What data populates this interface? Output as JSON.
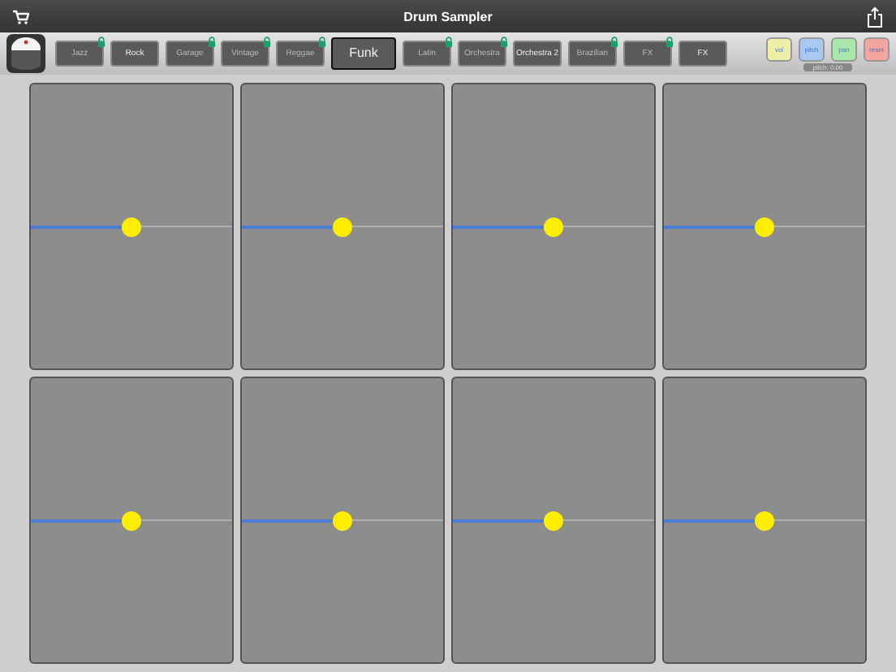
{
  "window": {
    "title": "Drum Sampler"
  },
  "kits": [
    {
      "label": "Jazz",
      "locked": true,
      "selected": false
    },
    {
      "label": "Rock",
      "locked": false,
      "selected": false
    },
    {
      "label": "Garage",
      "locked": true,
      "selected": false
    },
    {
      "label": "Vintage",
      "locked": true,
      "selected": false
    },
    {
      "label": "Reggae",
      "locked": true,
      "selected": false
    },
    {
      "label": "Funk",
      "locked": false,
      "selected": true
    },
    {
      "label": "Latin",
      "locked": true,
      "selected": false
    },
    {
      "label": "Orchestra",
      "locked": true,
      "selected": false
    },
    {
      "label": "Orchestra 2",
      "locked": false,
      "selected": false
    },
    {
      "label": "Brazilian",
      "locked": true,
      "selected": false
    },
    {
      "label": "FX",
      "locked": true,
      "selected": false
    },
    {
      "label": "FX",
      "locked": false,
      "selected": false
    }
  ],
  "modes": [
    {
      "label": "vol",
      "color": "#eef0a8"
    },
    {
      "label": "pitch",
      "color": "#a9c9f2"
    },
    {
      "label": "pan",
      "color": "#a8e8a8"
    },
    {
      "label": "reset",
      "color": "#f4a5a0"
    }
  ],
  "mode_readout": "pitch: 0.00",
  "pads": [
    {
      "level": 0.5
    },
    {
      "level": 0.5
    },
    {
      "level": 0.5
    },
    {
      "level": 0.5
    },
    {
      "level": 0.5
    },
    {
      "level": 0.5
    },
    {
      "level": 0.5
    },
    {
      "level": 0.5
    }
  ]
}
